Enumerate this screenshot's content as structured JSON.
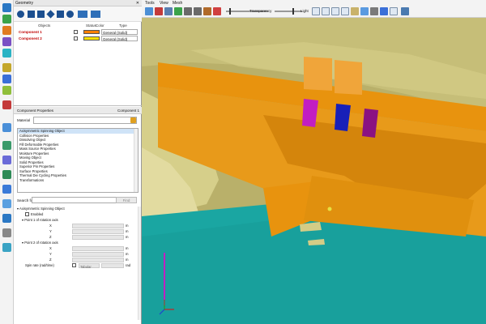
{
  "window": {
    "title": "Geometry"
  },
  "menu": [
    "Tools",
    "View",
    "Mesh"
  ],
  "toolbar": {
    "transparency_label": "Transparency",
    "light_label": "Light"
  },
  "components_table": {
    "headers": [
      "Objects",
      "Status",
      "Color",
      "Type"
    ],
    "rows": [
      {
        "name": "Component 1",
        "color": "#ff8000",
        "type": "General (Solid)"
      },
      {
        "name": "Component 2",
        "color": "#ffe000",
        "type": "General (Solid)"
      }
    ]
  },
  "properties_panel": {
    "title": "Component Properties",
    "component": "Component 1",
    "material_label": "Material",
    "list": [
      "Axisymmetric Spinning Object",
      "Collision Properties",
      "Dissolving Object",
      "Fill Deformable Properties",
      "Mass Source Properties",
      "Moisture Properties",
      "Moving Object",
      "Solid Properties",
      "Superior Pin Properties",
      "Surface Properties",
      "Thermal Die Cycling Properties",
      "Transformations"
    ],
    "search_label": "Search for:",
    "find_label": "Find"
  },
  "axisym": {
    "header": "Axisymmetric Spinning Object",
    "enabled_label": "Enabled",
    "point1_label": "Point 1 of rotation axis",
    "point2_label": "Point 2 of rotation axis",
    "coords": [
      "X",
      "Y",
      "Z"
    ],
    "unit": "m",
    "spin_label": "Spin rate (rad/time)",
    "spin_mode": "Tabular",
    "spin_unit": "rad"
  },
  "colors": {
    "dam": "#e8930e",
    "terrain": "#c9c07a",
    "water": "#1aa6a2",
    "gate_magenta": "#c21ec2",
    "gate_blue": "#1820b8",
    "gate_purple": "#8a1282"
  }
}
